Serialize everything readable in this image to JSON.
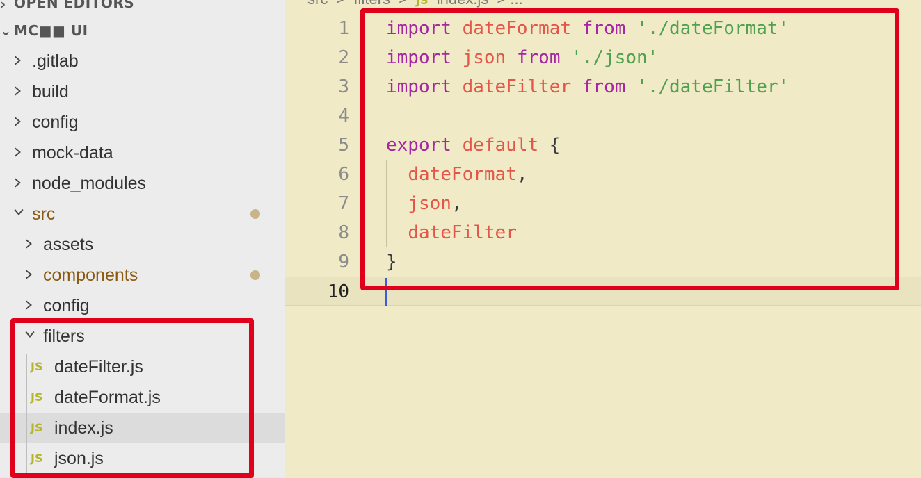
{
  "sidebar": {
    "open_editors_label": "OPEN EDITORS",
    "project_label": "MC■■ UI",
    "items": [
      {
        "label": "config",
        "depth": 0,
        "expanded": false
      },
      {
        "label": "mock-data",
        "depth": 0,
        "expanded": false
      },
      {
        "label": "node_modules",
        "depth": 0,
        "expanded": false
      },
      {
        "label": "src",
        "depth": 0,
        "expanded": true,
        "modified": true
      },
      {
        "label": "assets",
        "depth": 1,
        "expanded": false
      },
      {
        "label": "components",
        "depth": 1,
        "expanded": false,
        "modified": true
      },
      {
        "label": "config",
        "depth": 1,
        "expanded": false
      },
      {
        "label": "filters",
        "depth": 1,
        "expanded": true
      },
      {
        "label": "dateFilter.js",
        "depth": 2,
        "file": true
      },
      {
        "label": "dateFormat.js",
        "depth": 2,
        "file": true
      },
      {
        "label": "index.js",
        "depth": 2,
        "file": true,
        "selected": true
      },
      {
        "label": "json.js",
        "depth": 2,
        "file": true
      }
    ],
    "top_items": [
      {
        "label": ".gitlab"
      },
      {
        "label": "build"
      }
    ],
    "js_icon_text": "JS"
  },
  "breadcrumb": {
    "parts": [
      "src",
      ">",
      "filters",
      ">"
    ],
    "file_icon": "JS",
    "file": "index.js",
    "tail": "> ..."
  },
  "editor": {
    "lines": [
      {
        "n": "1",
        "tokens": [
          [
            "kw",
            "import"
          ],
          [
            "pn",
            " "
          ],
          [
            "id",
            "dateFormat"
          ],
          [
            "pn",
            " "
          ],
          [
            "kw",
            "from"
          ],
          [
            "pn",
            " "
          ],
          [
            "str",
            "'./dateFormat'"
          ]
        ]
      },
      {
        "n": "2",
        "tokens": [
          [
            "kw",
            "import"
          ],
          [
            "pn",
            " "
          ],
          [
            "id",
            "json"
          ],
          [
            "pn",
            " "
          ],
          [
            "kw",
            "from"
          ],
          [
            "pn",
            " "
          ],
          [
            "str",
            "'./json'"
          ]
        ]
      },
      {
        "n": "3",
        "tokens": [
          [
            "kw",
            "import"
          ],
          [
            "pn",
            " "
          ],
          [
            "id",
            "dateFilter"
          ],
          [
            "pn",
            " "
          ],
          [
            "kw",
            "from"
          ],
          [
            "pn",
            " "
          ],
          [
            "str",
            "'./dateFilter'"
          ]
        ]
      },
      {
        "n": "4",
        "tokens": []
      },
      {
        "n": "5",
        "tokens": [
          [
            "kw",
            "export"
          ],
          [
            "pn",
            " "
          ],
          [
            "id",
            "default"
          ],
          [
            "pn",
            " {"
          ]
        ]
      },
      {
        "n": "6",
        "tokens": [
          [
            "pn",
            "  "
          ],
          [
            "id",
            "dateFormat"
          ],
          [
            "pn",
            ","
          ]
        ]
      },
      {
        "n": "7",
        "tokens": [
          [
            "pn",
            "  "
          ],
          [
            "id",
            "json"
          ],
          [
            "pn",
            ","
          ]
        ]
      },
      {
        "n": "8",
        "tokens": [
          [
            "pn",
            "  "
          ],
          [
            "id",
            "dateFilter"
          ]
        ]
      },
      {
        "n": "9",
        "tokens": [
          [
            "pn",
            "}"
          ]
        ]
      },
      {
        "n": "10",
        "tokens": [],
        "current": true
      }
    ]
  },
  "colors": {
    "annotation": "#e0001b",
    "keyword": "#a626a4",
    "identifier": "#e45649",
    "string": "#50a14f",
    "cursor": "#3a5cd9"
  }
}
